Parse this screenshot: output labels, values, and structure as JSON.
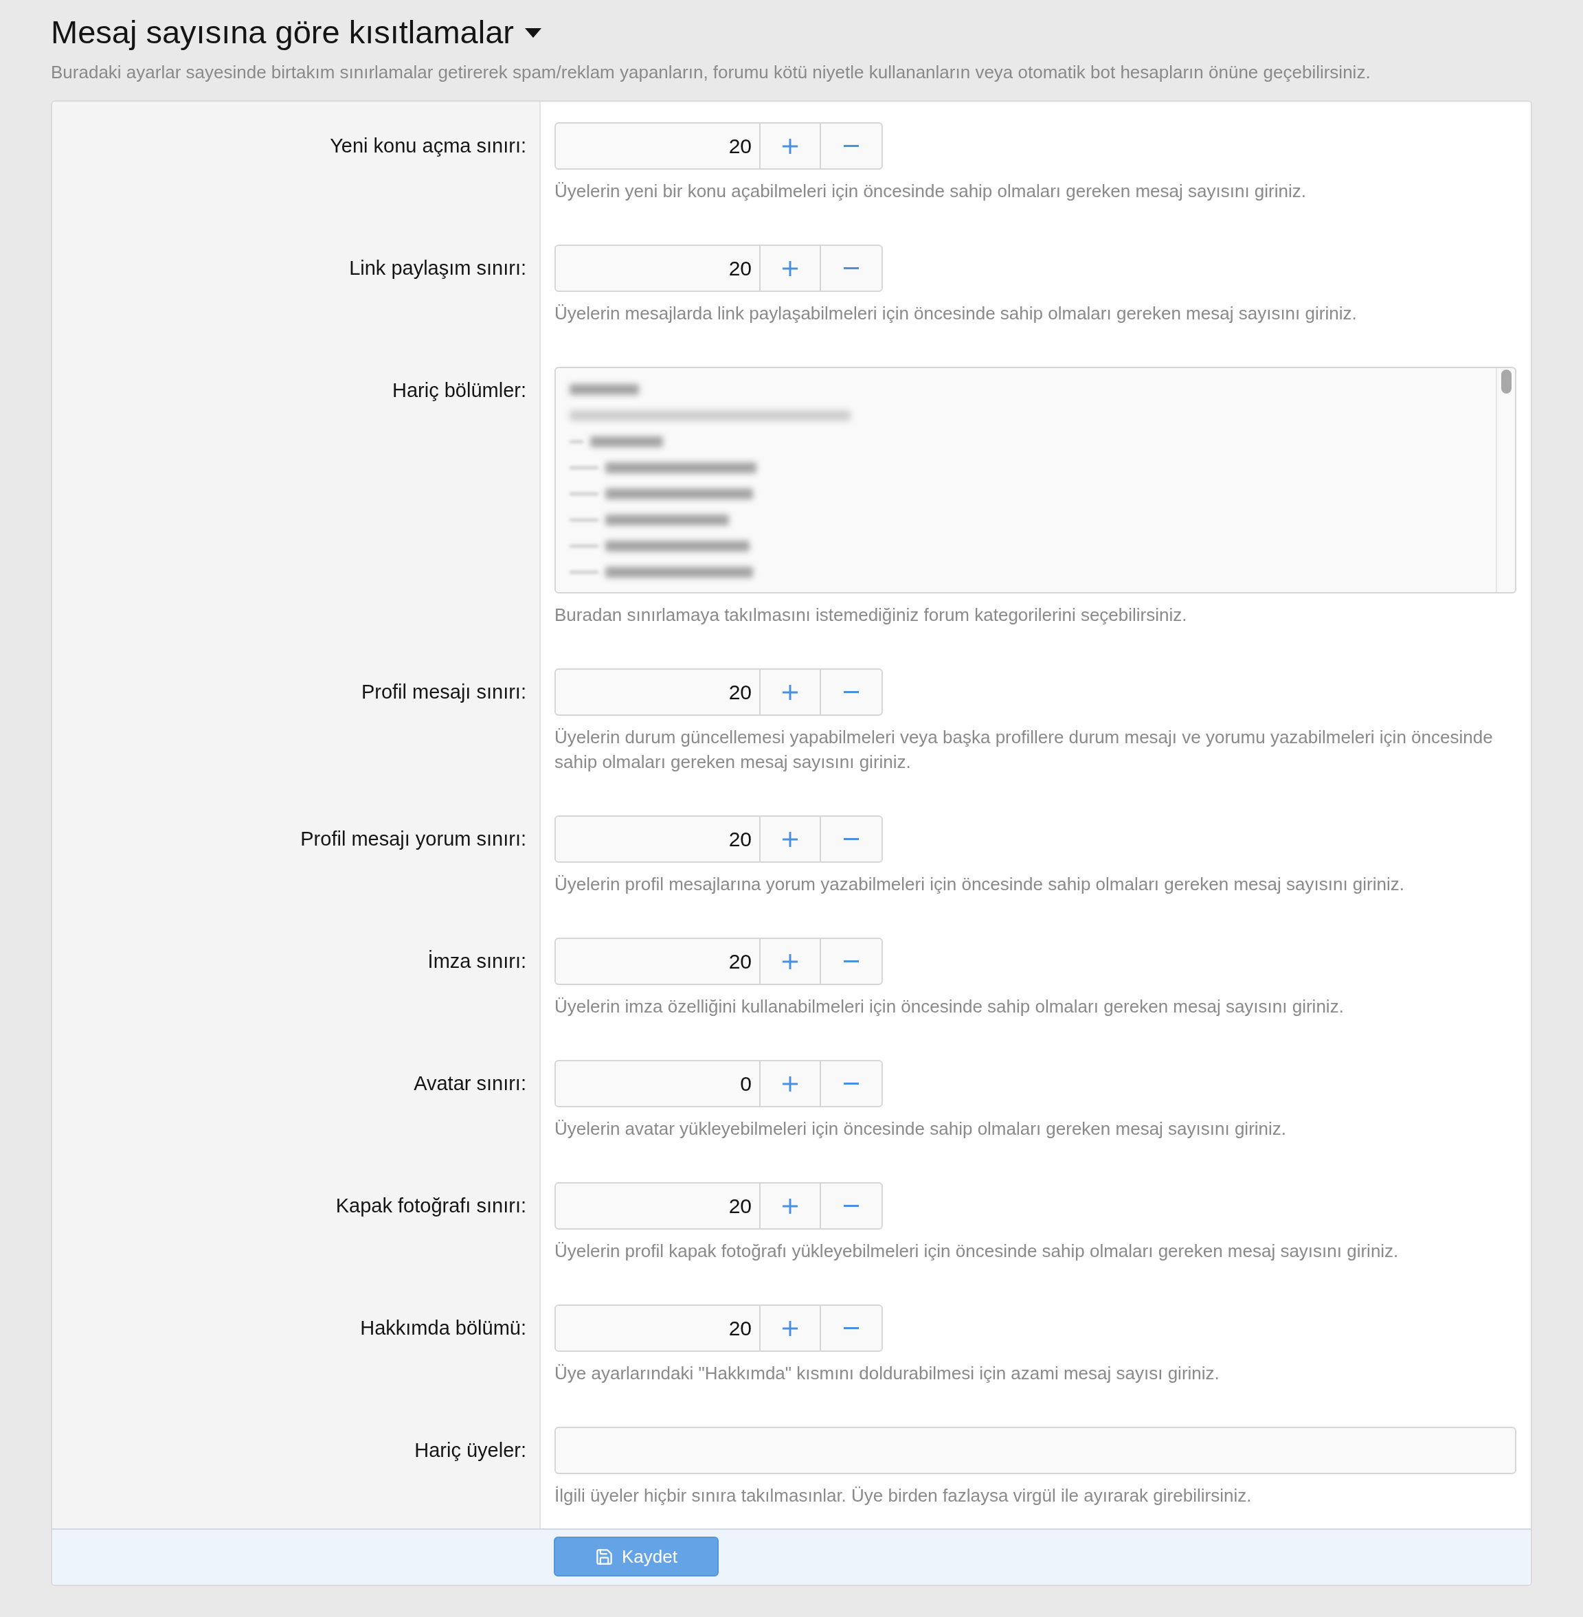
{
  "header": {
    "title": "Mesaj sayısına göre kısıtlamalar",
    "description": "Buradaki ayarlar sayesinde birtakım sınırlamalar getirerek spam/reklam yapanların, forumu kötü niyetle kullananların veya otomatik bot hesapların önüne geçebilirsiniz."
  },
  "settings": [
    {
      "kind": "number",
      "label": "Yeni konu açma sınırı:",
      "value": "20",
      "help": "Üyelerin yeni bir konu açabilmeleri için öncesinde sahip olmaları gereken mesaj sayısını giriniz."
    },
    {
      "kind": "number",
      "label": "Link paylaşım sınırı:",
      "value": "20",
      "help": "Üyelerin mesajlarda link paylaşabilmeleri için öncesinde sahip olmaları gereken mesaj sayısını giriniz."
    },
    {
      "kind": "multiselect",
      "label": "Hariç bölümler:",
      "help": "Buradan sınırlamaya takılmasını istemediğiniz forum kategorilerini seçebilirsiniz."
    },
    {
      "kind": "number",
      "label": "Profil mesajı sınırı:",
      "value": "20",
      "help": "Üyelerin durum güncellemesi yapabilmeleri veya başka profillere durum mesajı ve yorumu yazabilmeleri için öncesinde sahip olmaları gereken mesaj sayısını giriniz."
    },
    {
      "kind": "number",
      "label": "Profil mesajı yorum sınırı:",
      "value": "20",
      "help": "Üyelerin profil mesajlarına yorum yazabilmeleri için öncesinde sahip olmaları gereken mesaj sayısını giriniz."
    },
    {
      "kind": "number",
      "label": "İmza sınırı:",
      "value": "20",
      "help": "Üyelerin imza özelliğini kullanabilmeleri için öncesinde sahip olmaları gereken mesaj sayısını giriniz."
    },
    {
      "kind": "number",
      "label": "Avatar sınırı:",
      "value": "0",
      "help": "Üyelerin avatar yükleyebilmeleri için öncesinde sahip olmaları gereken mesaj sayısını giriniz."
    },
    {
      "kind": "number",
      "label": "Kapak fotoğrafı sınırı:",
      "value": "20",
      "help": "Üyelerin profil kapak fotoğrafı yükleyebilmeleri için öncesinde sahip olmaları gereken mesaj sayısını giriniz."
    },
    {
      "kind": "number",
      "label": "Hakkımda bölümü:",
      "value": "20",
      "help": "Üye ayarlarındaki \"Hakkımda\" kısmını doldurabilmesi için azami mesaj sayısı giriniz."
    },
    {
      "kind": "text",
      "label": "Hariç üyeler:",
      "help": "İlgili üyeler hiçbir sınıra takılmasınlar. Üye birden fazlaysa virgül ile ayırarak girebilirsiniz."
    }
  ],
  "footer": {
    "save_button": "Kaydet"
  }
}
